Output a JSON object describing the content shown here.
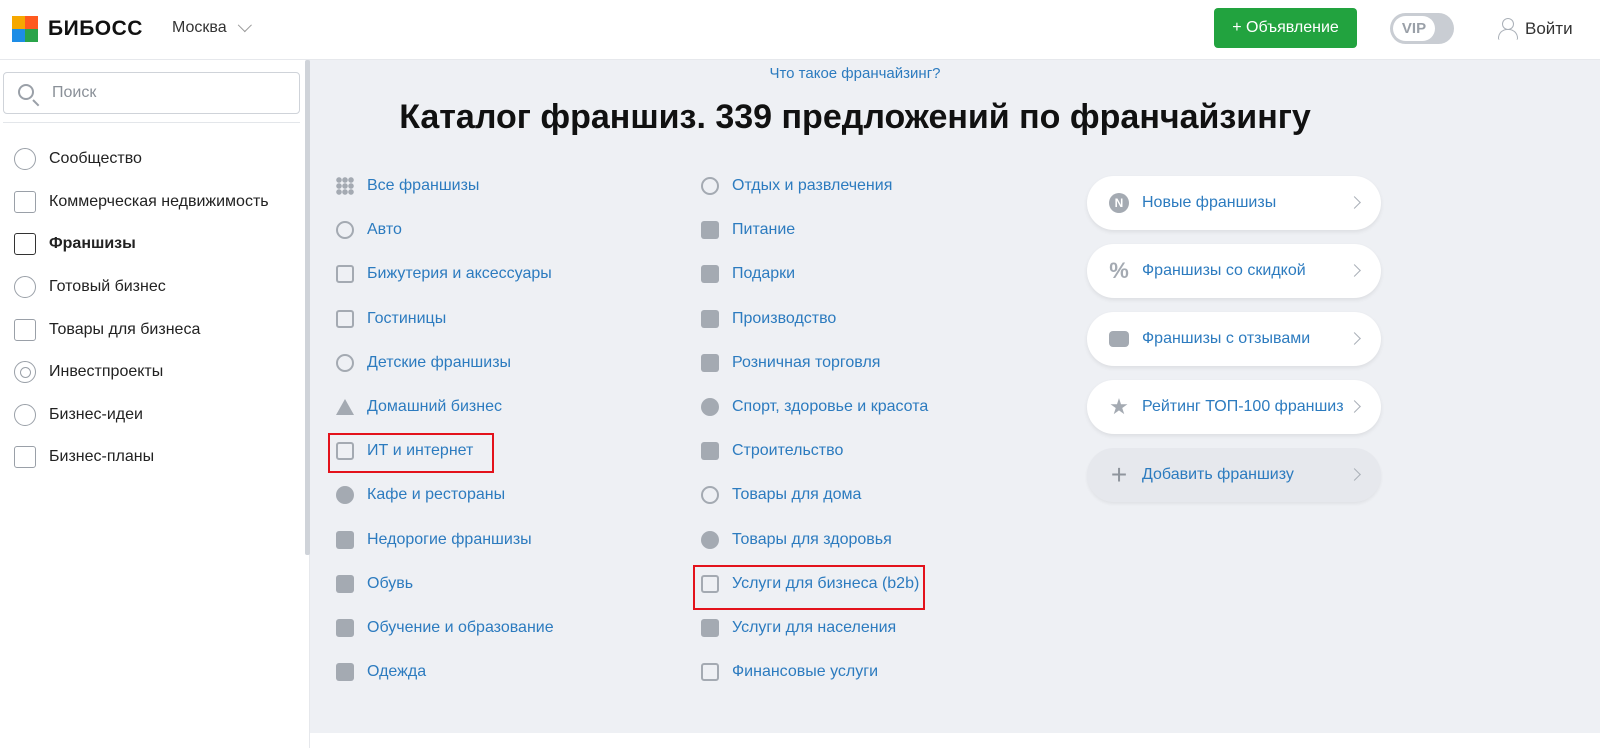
{
  "header": {
    "logo_text": "БИБОСС",
    "city": "Москва",
    "ad_button": "+ Объявление",
    "vip_label": "VIP",
    "login_label": "Войти"
  },
  "sidebar": {
    "search_placeholder": "Поиск",
    "items": [
      {
        "label": "Сообщество",
        "icon": "question-circle-icon"
      },
      {
        "label": "Коммерческая недвижимость",
        "icon": "store-icon"
      },
      {
        "label": "Франшизы",
        "icon": "briefcase-icon",
        "active": true
      },
      {
        "label": "Готовый бизнес",
        "icon": "chair-icon"
      },
      {
        "label": "Товары для бизнеса",
        "icon": "box-icon"
      },
      {
        "label": "Инвестпроекты",
        "icon": "dollar-circle-icon"
      },
      {
        "label": "Бизнес-идеи",
        "icon": "lightbulb-icon"
      },
      {
        "label": "Бизнес-планы",
        "icon": "clipboard-check-icon"
      }
    ]
  },
  "main": {
    "what_link": "Что такое франчайзинг?",
    "title": "Каталог франшиз. 339 предложений по франчайзингу",
    "col1": [
      "Все франшизы",
      "Авто",
      "Бижутерия и аксессуары",
      "Гостиницы",
      "Детские франшизы",
      "Домашний бизнес",
      "ИТ и интернет",
      "Кафе и рестораны",
      "Недорогие франшизы",
      "Обувь",
      "Обучение и образование",
      "Одежда"
    ],
    "col2": [
      "Отдых и развлечения",
      "Питание",
      "Подарки",
      "Производство",
      "Розничная торговля",
      "Спорт, здоровье и красота",
      "Строительство",
      "Товары для дома",
      "Товары для здоровья",
      "Услуги для бизнеса (b2b)",
      "Услуги для населения",
      "Финансовые услуги"
    ],
    "cards": [
      {
        "label": "Новые франшизы",
        "icon": "new-badge-icon",
        "glyph": "N"
      },
      {
        "label": "Франшизы со скидкой",
        "icon": "percent-icon",
        "glyph": "%"
      },
      {
        "label": "Франшизы с отзывами",
        "icon": "chat-bubble-icon",
        "glyph": ""
      },
      {
        "label": "Рейтинг ТОП-100 франшиз",
        "icon": "star-icon",
        "glyph": "★"
      },
      {
        "label": "Добавить франшизу",
        "icon": "plus-icon",
        "glyph": "+"
      }
    ],
    "highlighted": [
      "ИТ и интернет",
      "Услуги для бизнеса (b2b)"
    ]
  },
  "colors": {
    "accent_green": "#22a33f",
    "link_blue": "#2c7bbf",
    "highlight_red": "#e3121b",
    "main_bg": "#eef0f4"
  }
}
